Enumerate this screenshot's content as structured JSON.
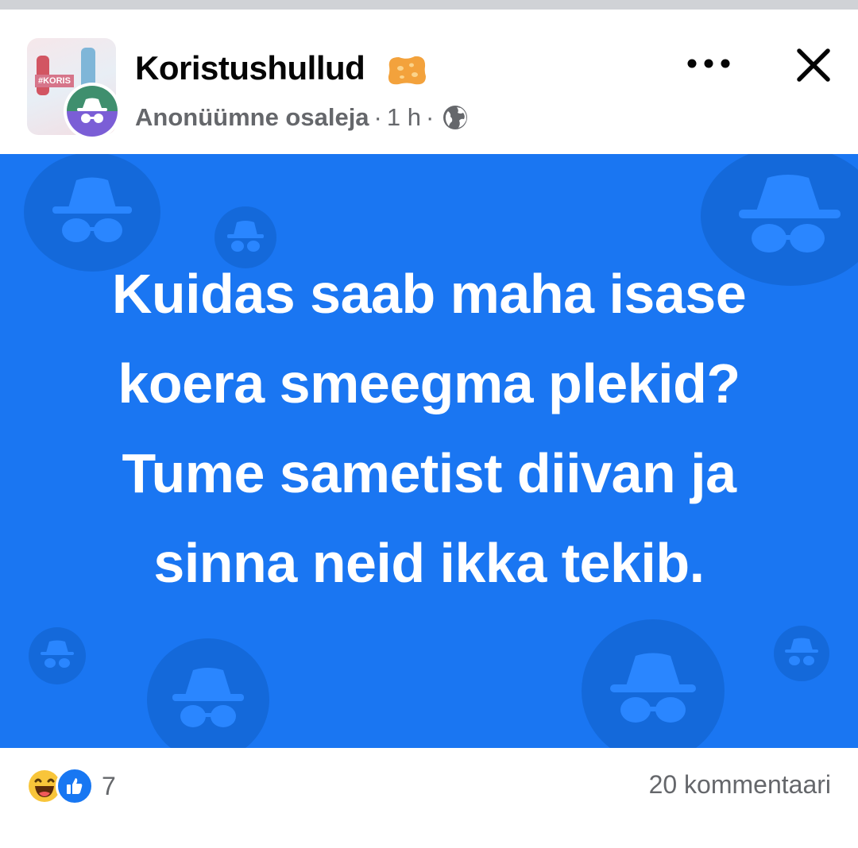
{
  "post": {
    "group_name": "Koristushullud",
    "author": "Anonüümne osaleja",
    "dot_separator": "·",
    "time": "1 h",
    "text": "Kuidas saab maha isase koera smeegma plekid? Tume sametist diivan ja sinna neid ikka tekib.",
    "background_color": "#1a76f2"
  },
  "group_thumbnail": {
    "text": "#KORIS"
  },
  "footer": {
    "reaction_count": "7",
    "comments": "20 kommentaari"
  },
  "icons": {
    "group_badge": "sponge-icon",
    "privacy": "globe-icon",
    "more": "more-horizontal-icon",
    "close": "close-icon",
    "reaction_1": "haha-reaction-icon",
    "reaction_2": "like-reaction-icon"
  }
}
